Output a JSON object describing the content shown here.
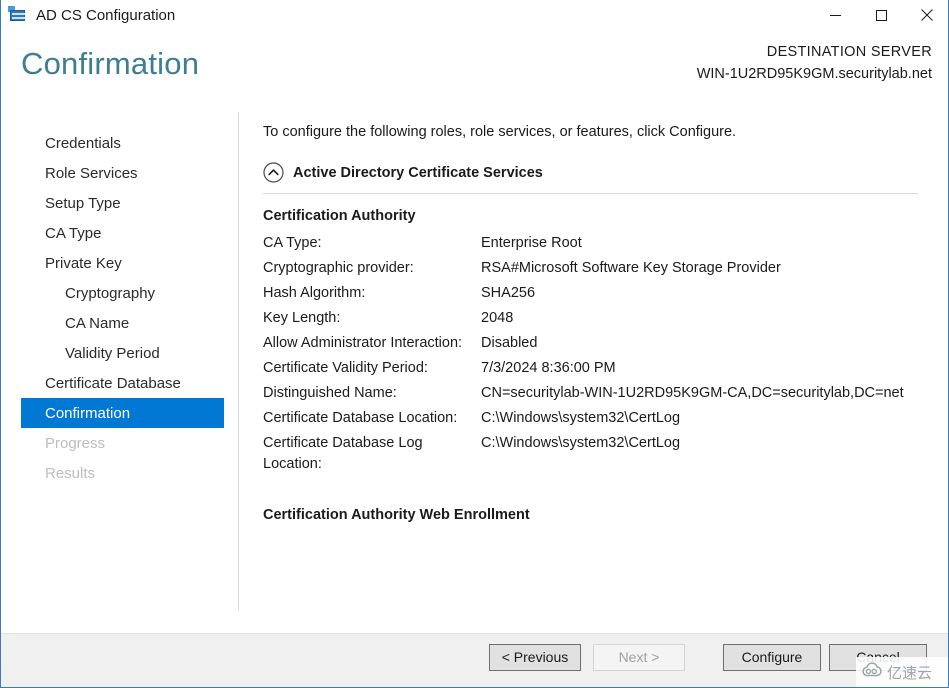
{
  "window": {
    "title": "AD CS Configuration",
    "icon": "server-certificate-icon",
    "minimize_label": "Minimize",
    "maximize_label": "Maximize",
    "close_label": "Close"
  },
  "header": {
    "page_title": "Confirmation",
    "destination_label": "DESTINATION SERVER",
    "destination_server": "WIN-1U2RD95K9GM.securitylab.net"
  },
  "sidebar": {
    "items": [
      {
        "label": "Credentials",
        "indent": false,
        "state": "normal"
      },
      {
        "label": "Role Services",
        "indent": false,
        "state": "normal"
      },
      {
        "label": "Setup Type",
        "indent": false,
        "state": "normal"
      },
      {
        "label": "CA Type",
        "indent": false,
        "state": "normal"
      },
      {
        "label": "Private Key",
        "indent": false,
        "state": "normal"
      },
      {
        "label": "Cryptography",
        "indent": true,
        "state": "normal"
      },
      {
        "label": "CA Name",
        "indent": true,
        "state": "normal"
      },
      {
        "label": "Validity Period",
        "indent": true,
        "state": "normal"
      },
      {
        "label": "Certificate Database",
        "indent": false,
        "state": "normal"
      },
      {
        "label": "Confirmation",
        "indent": false,
        "state": "selected"
      },
      {
        "label": "Progress",
        "indent": false,
        "state": "disabled"
      },
      {
        "label": "Results",
        "indent": false,
        "state": "disabled"
      }
    ]
  },
  "main": {
    "intro": "To configure the following roles, role services, or features, click Configure.",
    "section_title": "Active Directory Certificate Services",
    "collapse_icon": "chevron-up-circle-icon",
    "subsection_title": "Certification Authority",
    "details": [
      {
        "key": "CA Type:",
        "value": "Enterprise Root"
      },
      {
        "key": "Cryptographic provider:",
        "value": "RSA#Microsoft Software Key Storage Provider"
      },
      {
        "key": "Hash Algorithm:",
        "value": "SHA256"
      },
      {
        "key": "Key Length:",
        "value": "2048"
      },
      {
        "key": "Allow Administrator Interaction:",
        "value": "Disabled"
      },
      {
        "key": "Certificate Validity Period:",
        "value": "7/3/2024 8:36:00 PM"
      },
      {
        "key": "Distinguished Name:",
        "value": "CN=securitylab-WIN-1U2RD95K9GM-CA,DC=securitylab,DC=net"
      },
      {
        "key": "Certificate Database Location:",
        "value": "C:\\Windows\\system32\\CertLog"
      },
      {
        "key": "Certificate Database Log Location:",
        "value": "C:\\Windows\\system32\\CertLog"
      }
    ],
    "subsection_title_2": "Certification Authority Web Enrollment"
  },
  "footer": {
    "previous_label": "< Previous",
    "next_label": "Next >",
    "configure_label": "Configure",
    "cancel_label": "Cancel"
  },
  "watermark": {
    "text": "亿速云",
    "logo": "cloud-icon"
  },
  "colors": {
    "accent_selected": "#0078d4",
    "page_title": "#3f7d92",
    "footer_bg": "#f0f0f0",
    "window_border": "#3a7bbf",
    "disabled_text": "#bdbdbd"
  }
}
